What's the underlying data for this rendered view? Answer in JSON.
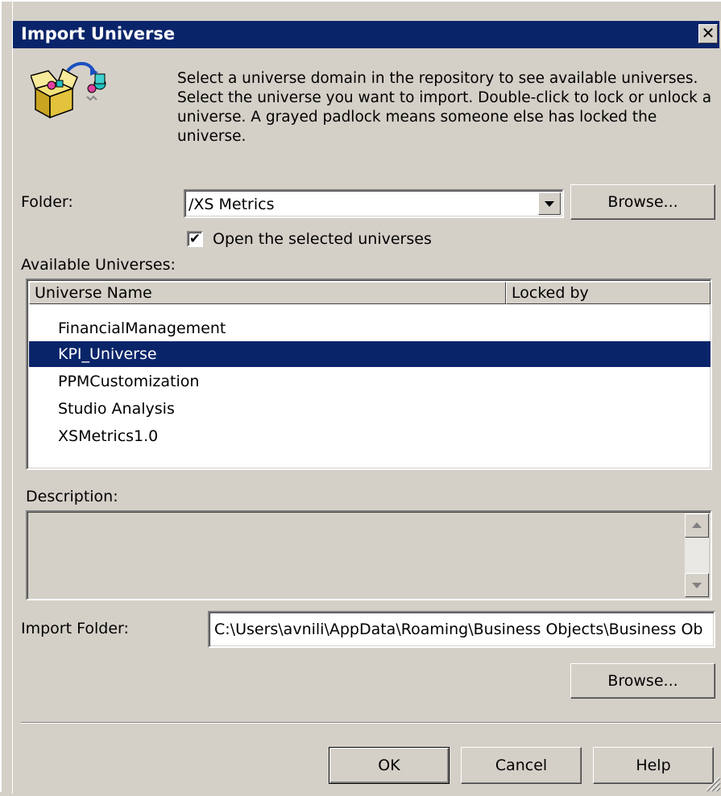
{
  "window": {
    "title": "Import Universe",
    "close_glyph": "✕"
  },
  "header": {
    "icon": "import-universe-icon",
    "description": "Select a universe domain in the repository to see available universes. Select the universe you want to import. Double-click to lock or unlock a universe. A grayed padlock means someone else has locked the universe."
  },
  "folder": {
    "label": "Folder:",
    "value": "/XS Metrics",
    "browse_label": "Browse..."
  },
  "open_selected": {
    "label": "Open the selected universes",
    "checked": true,
    "check_glyph": "✔"
  },
  "available": {
    "label": "Available Universes:",
    "columns": [
      "Universe Name",
      "Locked by"
    ],
    "items": [
      {
        "name": "FinancialManagement",
        "selected": false
      },
      {
        "name": "KPI_Universe",
        "selected": true
      },
      {
        "name": "PPMCustomization",
        "selected": false
      },
      {
        "name": "Studio Analysis",
        "selected": false
      },
      {
        "name": "XSMetrics1.0",
        "selected": false
      }
    ]
  },
  "description": {
    "label": "Description:",
    "value": ""
  },
  "import_folder": {
    "label": "Import Folder:",
    "value": "C:\\Users\\avnili\\AppData\\Roaming\\Business Objects\\Business Ob",
    "browse_label": "Browse..."
  },
  "footer": {
    "ok_label": "OK",
    "cancel_label": "Cancel",
    "help_label": "Help"
  },
  "colors": {
    "face": "#d4d0c8",
    "titlebar": "#0a246a",
    "selection": "#0a246a"
  }
}
